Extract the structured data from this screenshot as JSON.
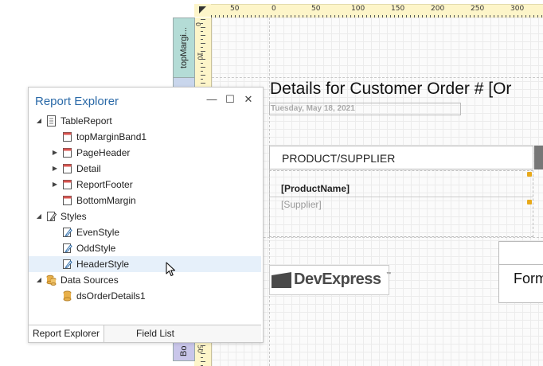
{
  "ruler": {
    "top_labels": [
      "50",
      "0",
      "50",
      "100",
      "150",
      "200",
      "250",
      "300"
    ],
    "left_labels": [
      "0",
      "10",
      "50"
    ]
  },
  "bands": {
    "top_margin": "topMargi...",
    "bottom_margin": "Bo"
  },
  "report": {
    "title": "Details for Customer Order # [Or",
    "date": "Tuesday, May 18, 2021",
    "header_column": "PRODUCT/SUPPLIER",
    "product_name": "[ProductName]",
    "supplier": "[Supplier]",
    "logo_text": "DevExpress",
    "logo_tm": "™",
    "form_text": "Form"
  },
  "panel": {
    "title": "Report Explorer",
    "buttons": {
      "minimize": "—",
      "maximize": "☐",
      "close": "✕"
    },
    "tree": [
      {
        "label": "TableReport",
        "icon": "report-icon",
        "expander": "◢"
      },
      {
        "label": "topMarginBand1",
        "icon": "band-icon",
        "expander": ""
      },
      {
        "label": "PageHeader",
        "icon": "band-icon",
        "expander": "▶"
      },
      {
        "label": "Detail",
        "icon": "band-icon",
        "expander": "▶"
      },
      {
        "label": "ReportFooter",
        "icon": "band-icon",
        "expander": "▶"
      },
      {
        "label": "BottomMargin",
        "icon": "band-icon",
        "expander": ""
      },
      {
        "label": "Styles",
        "icon": "styles-icon",
        "expander": "◢"
      },
      {
        "label": "EvenStyle",
        "icon": "style-icon",
        "expander": ""
      },
      {
        "label": "OddStyle",
        "icon": "style-icon",
        "expander": ""
      },
      {
        "label": "HeaderStyle",
        "icon": "style-icon",
        "expander": ""
      },
      {
        "label": "Data Sources",
        "icon": "datasources-icon",
        "expander": "◢"
      },
      {
        "label": "dsOrderDetails1",
        "icon": "database-icon",
        "expander": ""
      }
    ],
    "tabs": [
      "Report Explorer",
      "Field List"
    ]
  },
  "colors": {
    "accent": "#2b6aa8",
    "ruler": "#fdf5c9",
    "handle": "#e8a91b",
    "band_top": "#b4dcd6",
    "band_mid": "#c9d6ec",
    "band_bottom": "#c9c6ea"
  }
}
